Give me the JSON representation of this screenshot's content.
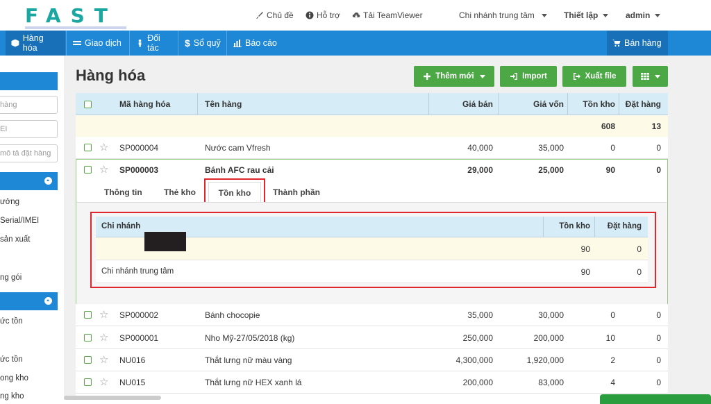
{
  "logo": {
    "text": "FAST"
  },
  "topbar": {
    "links": [
      {
        "icon": "brush-icon",
        "label": "Chủ đề"
      },
      {
        "icon": "info-icon",
        "label": "Hỗ trợ"
      },
      {
        "icon": "cloud-download-icon",
        "label": "Tải TeamViewer"
      }
    ],
    "branch": "Chi nhánh trung tâm",
    "settings": "Thiết lập",
    "user": "admin"
  },
  "nav": {
    "items": [
      {
        "icon": "box-icon",
        "label": "Hàng hóa"
      },
      {
        "icon": "exchange-icon",
        "label": "Giao dịch"
      },
      {
        "icon": "person-icon",
        "label": "Đối tác"
      },
      {
        "icon": "dollar-icon",
        "label": "Sổ quỹ"
      },
      {
        "icon": "bar-chart-icon",
        "label": "Báo cáo"
      }
    ],
    "sell": {
      "icon": "cart-icon",
      "label": "Bán hàng"
    }
  },
  "sidebar": {
    "inputs": [
      "hàng",
      "EI",
      "mô tả đặt hàng"
    ],
    "group1": [
      "ưởng",
      "Serial/IMEI",
      "sản xuất",
      "ng gói"
    ],
    "group2": [
      "ức tồn",
      "ức tồn",
      "ong kho",
      "ng kho"
    ]
  },
  "page": {
    "title": "Hàng hóa",
    "buttons": {
      "add": "Thêm mới",
      "import": "Import",
      "export": "Xuất file"
    }
  },
  "table": {
    "headers": [
      "Mã hàng hóa",
      "Tên hàng",
      "Giá bán",
      "Giá vốn",
      "Tồn kho",
      "Đặt hàng"
    ],
    "totals": {
      "stock": "608",
      "ordered": "13"
    },
    "rows": [
      {
        "code": "SP000004",
        "name": "Nước cam Vfresh",
        "price": "40,000",
        "cost": "35,000",
        "stock": "0",
        "ordered": "0"
      },
      {
        "code": "SP000003",
        "name": "Bánh AFC rau cải",
        "price": "29,000",
        "cost": "25,000",
        "stock": "90",
        "ordered": "0"
      },
      {
        "code": "SP000002",
        "name": "Bánh chocopie",
        "price": "35,000",
        "cost": "30,000",
        "stock": "0",
        "ordered": "0"
      },
      {
        "code": "SP000001",
        "name": "Nho Mỹ-27/05/2018 (kg)",
        "price": "250,000",
        "cost": "200,000",
        "stock": "10",
        "ordered": "0"
      },
      {
        "code": "NU016",
        "name": "Thắt lưng nữ màu vàng",
        "price": "4,300,000",
        "cost": "1,920,000",
        "stock": "2",
        "ordered": "0"
      },
      {
        "code": "NU015",
        "name": "Thắt lưng nữ HEX xanh lá",
        "price": "200,000",
        "cost": "83,000",
        "stock": "4",
        "ordered": "0"
      }
    ]
  },
  "detail": {
    "tabs": [
      "Thông tin",
      "Thẻ kho",
      "Tồn kho",
      "Thành phần"
    ],
    "sub_headers": [
      "Chi nhánh",
      "Tồn kho",
      "Đặt hàng"
    ],
    "sub_totals": {
      "stock": "90",
      "ordered": "0"
    },
    "sub_rows": [
      {
        "branch": "Chi nhánh trung tâm",
        "stock": "90",
        "ordered": "0"
      }
    ]
  },
  "colors": {
    "primary": "#1f88d6",
    "success": "#4ca845",
    "highlight": "#e0262c",
    "logo": "#1aa7a2"
  }
}
